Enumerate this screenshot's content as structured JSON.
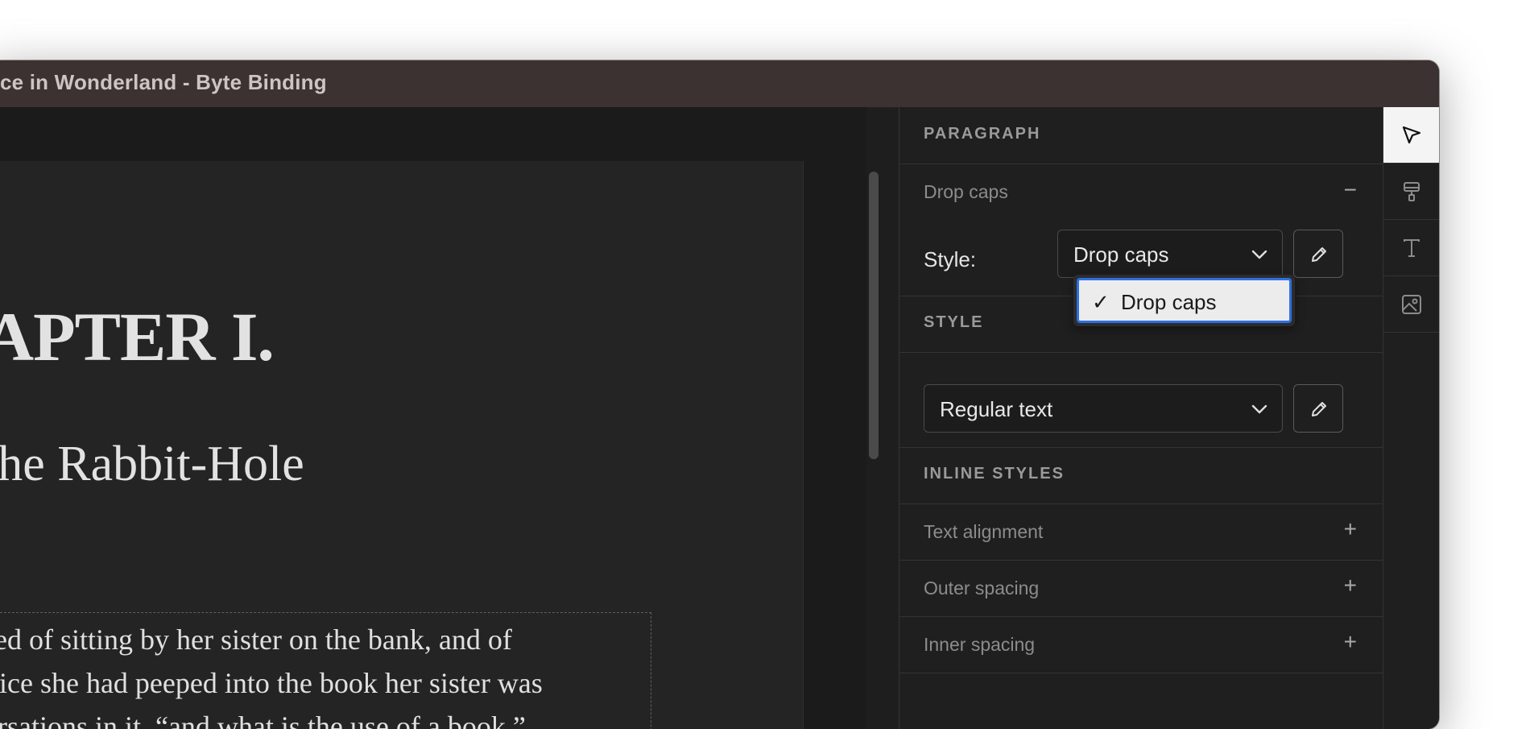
{
  "window": {
    "title": "ce in Wonderland - Byte Binding"
  },
  "document": {
    "chapter_title": "APTER I.",
    "subtitle": "the Rabbit-Hole",
    "paragraph_lines": [
      "red of sitting by her sister on the bank, and of",
      "vice she had peeped into the book her sister was",
      "ersations in it, “and what is the use of a book,”"
    ]
  },
  "panel": {
    "paragraph": {
      "heading": "PARAGRAPH",
      "drop_caps_label": "Drop caps",
      "drop_caps_action": "−",
      "style_label": "Style:",
      "style_value": "Drop caps",
      "dropdown_options": [
        {
          "label": "Drop caps",
          "check": "✓",
          "selected": true
        }
      ]
    },
    "style": {
      "heading": "STYLE",
      "value": "Regular text"
    },
    "inline_styles": {
      "heading": "INLINE STYLES",
      "rows": [
        {
          "label": "Text alignment",
          "action": "+"
        },
        {
          "label": "Outer spacing",
          "action": "+"
        },
        {
          "label": "Inner spacing",
          "action": "+"
        }
      ]
    }
  },
  "toolbar": {
    "tools": [
      "pointer-icon",
      "paint-roller-icon",
      "text-icon",
      "image-icon"
    ],
    "active": "pointer-icon"
  },
  "colors": {
    "accent": "#2f6fe4",
    "titlebar": "#3d3232",
    "panel": "#1f1f1f"
  }
}
